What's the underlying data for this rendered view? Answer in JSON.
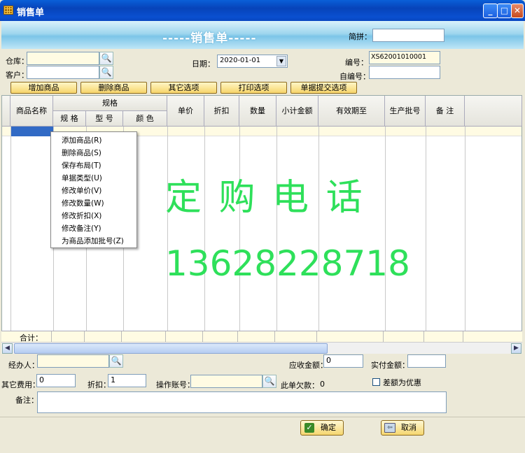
{
  "window": {
    "title": "销售单",
    "min": "_",
    "max": "□",
    "close": "✕"
  },
  "banner": {
    "title": "-----销售单-----",
    "jianpin_label": "简拼：",
    "jianpin_value": ""
  },
  "form": {
    "warehouse_label": "仓库：",
    "warehouse_value": "",
    "customer_label": "客户：",
    "customer_value": "",
    "date_label": "日期：",
    "date_value": "2020-01-01",
    "number_label": "编号：",
    "number_value": "XS62001010001",
    "custom_number_label": "自编号：",
    "custom_number_value": ""
  },
  "toolbar": [
    "增加商品",
    "删除商品",
    "其它选项",
    "打印选项",
    "单据提交选项"
  ],
  "grid": {
    "columns": [
      "商品名称",
      "规格",
      "单价",
      "折扣",
      "数量",
      "小计金额",
      "有效期至",
      "生产批号",
      "备 注"
    ],
    "sub_columns": [
      "规 格",
      "型 号",
      "颜 色"
    ],
    "total_label": "合计："
  },
  "context_menu": [
    "添加商品(R)",
    "删除商品(S)",
    "保存布局(T)",
    "单据类型(U)",
    "修改单价(V)",
    "修改数量(W)",
    "修改折扣(X)",
    "修改备注(Y)",
    "为商品添加批号(Z)"
  ],
  "promo": {
    "line1": "定 购 电 话",
    "line2": "13628228718"
  },
  "footer": {
    "handler_label": "经办人：",
    "handler_value": "",
    "receivable_label": "应收金额：",
    "receivable_value": "0",
    "paid_label": "实付金额：",
    "paid_value": "",
    "other_fee_label": "其它费用：",
    "other_fee_value": "0",
    "discount_label": "折扣：",
    "discount_value": "1",
    "account_label": "操作账号：",
    "account_value": "",
    "owed_label": "此单欠款：",
    "owed_value": "0",
    "checkbox_label": "差额为优惠",
    "remark_label": "备注：",
    "remark_value": "",
    "ok": "确定",
    "cancel": "取消"
  }
}
